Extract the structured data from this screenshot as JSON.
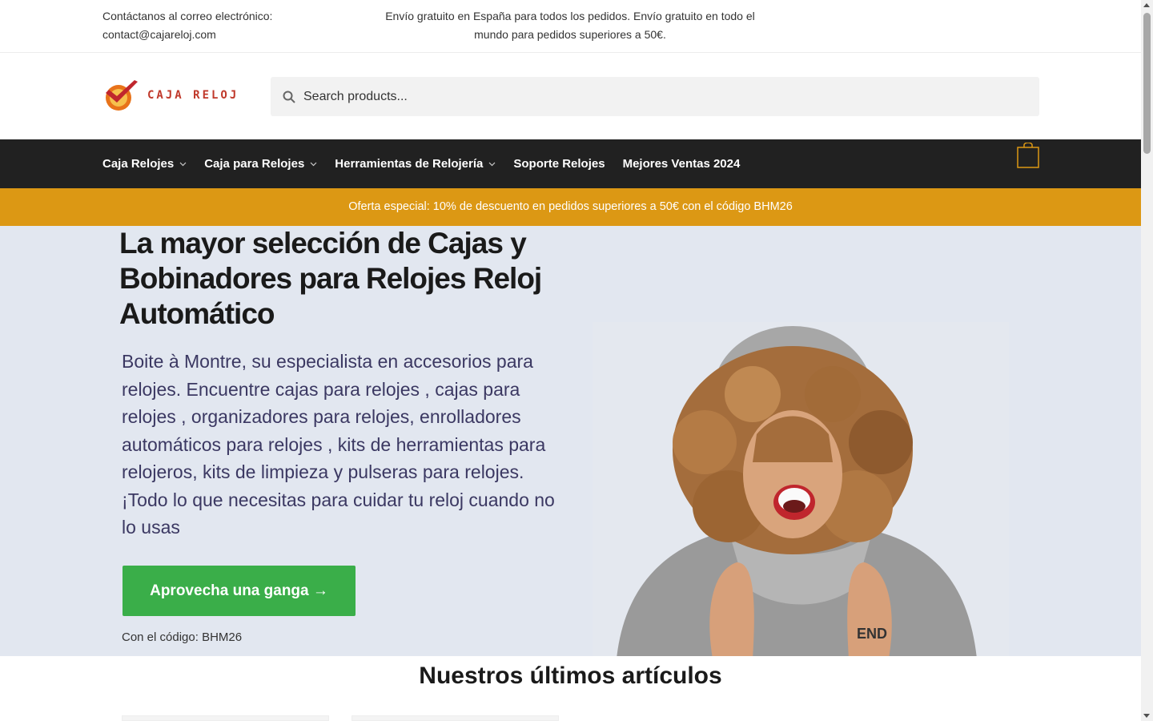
{
  "topbar": {
    "contact_line1": "Contáctanos al correo electrónico:",
    "contact_line2": "contact@cajareloj.com",
    "shipping": "Envío gratuito en España para todos los pedidos. Envío gratuito en todo el mundo para pedidos superiores a 50€."
  },
  "header": {
    "logo_text": "CAJA RELOJ",
    "search_placeholder": "Search products..."
  },
  "nav": {
    "items": [
      {
        "label": "Caja Relojes",
        "dropdown": true
      },
      {
        "label": "Caja para Relojes",
        "dropdown": true
      },
      {
        "label": "Herramientas de Relojería",
        "dropdown": true
      },
      {
        "label": "Soporte Relojes",
        "dropdown": false
      },
      {
        "label": "Mejores Ventas 2024",
        "dropdown": false
      }
    ]
  },
  "promo": {
    "text": "Oferta especial: 10% de descuento en pedidos superiores a 50€ con el código BHM26"
  },
  "hero": {
    "title": "La mayor selección de Cajas y Bobinadores para Relojes Reloj Automático",
    "lead": "Boite à Montre, su especialista en accesorios para relojes. Encuentre cajas para relojes , cajas para relojes , organizadores para relojes, enrolladores automáticos para relojes , kits de herramientas para relojeros, kits de limpieza y pulseras para relojes. ¡Todo lo que necesitas para cuidar tu reloj cuando no lo usas",
    "cta": "Aprovecha una ganga →",
    "code": "Con el código: BHM26"
  },
  "latest": {
    "title": "Nuestros últimos artículos"
  },
  "colors": {
    "nav_bg": "#212121",
    "promo_bg": "#dc9814",
    "hero_bg": "#e2e7f0",
    "cta_bg": "#3aae49",
    "cart_accent": "#dc9814",
    "logo_red": "#c0392b"
  }
}
